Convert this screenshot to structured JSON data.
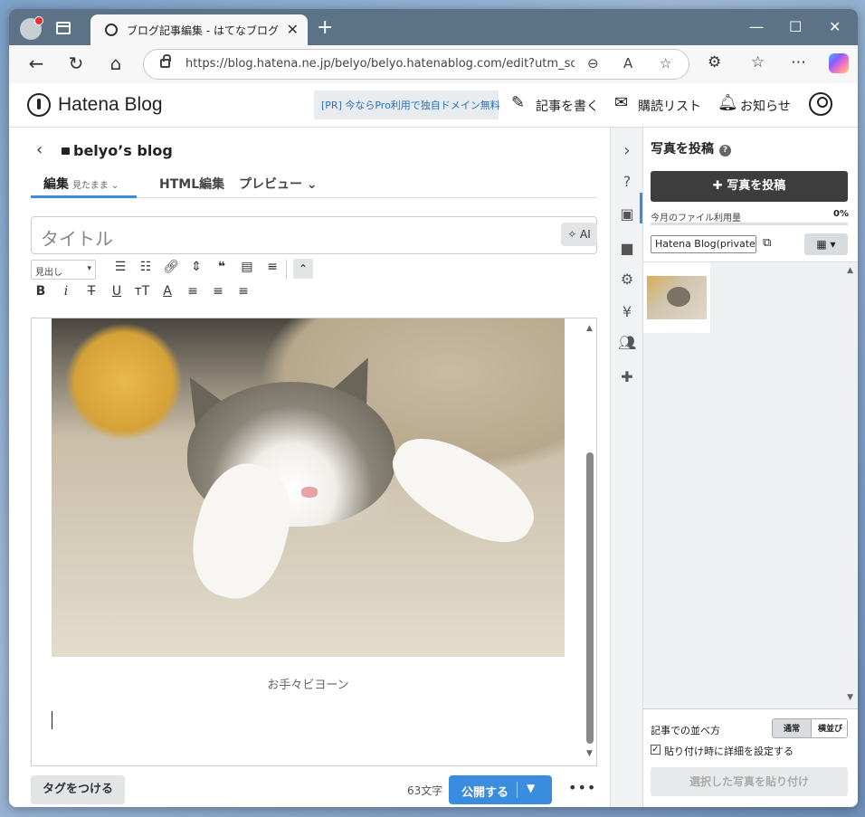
{
  "browser": {
    "tab_title": "ブログ記事編集 - はてなブログ",
    "url": "https://blog.hatena.ne.jp/belyo/belyo.hatenablog.com/edit?utm_so...",
    "close_glyph": "✕",
    "new_tab_glyph": "+"
  },
  "site_header": {
    "logo_text": "Hatena Blog",
    "pr_text": "[PR] 今ならPro利用で独自ドメイン無料",
    "write_label": "記事を書く",
    "reading_list_label": "購読リスト",
    "notifications_label": "お知らせ"
  },
  "editor": {
    "blog_name": "belyo’s blog",
    "tabs": [
      {
        "label": "編集",
        "sub": "見たまま ⌄"
      },
      {
        "label": "HTML編集"
      },
      {
        "label": "プレビュー ⌄"
      }
    ],
    "title_placeholder": "タイトル",
    "ai_label": "✧ AI",
    "format_select": "見出し",
    "image_caption": "お手々ビヨーン",
    "tag_button": "タグをつける",
    "char_count": "63文字",
    "publish_button": "公開する",
    "more_glyph": "•••"
  },
  "photo_panel": {
    "title": "写真を投稿",
    "upload_button": "✚ 写真を投稿",
    "usage_label": "今月のファイル利用量",
    "usage_value": "0%",
    "usage_fraction": 0,
    "album_select": "Hatena Blog(private)",
    "sort_label": "記事での並べ方",
    "sort_options": [
      "通常",
      "横並び"
    ],
    "paste_detail_label": "貼り付け時に詳細を設定する",
    "paste_button": "選択した写真を貼り付け"
  },
  "colors": {
    "accent": "#3a8dde",
    "tab_strip": "#5b7287",
    "dark_button": "#3d3d3d"
  }
}
